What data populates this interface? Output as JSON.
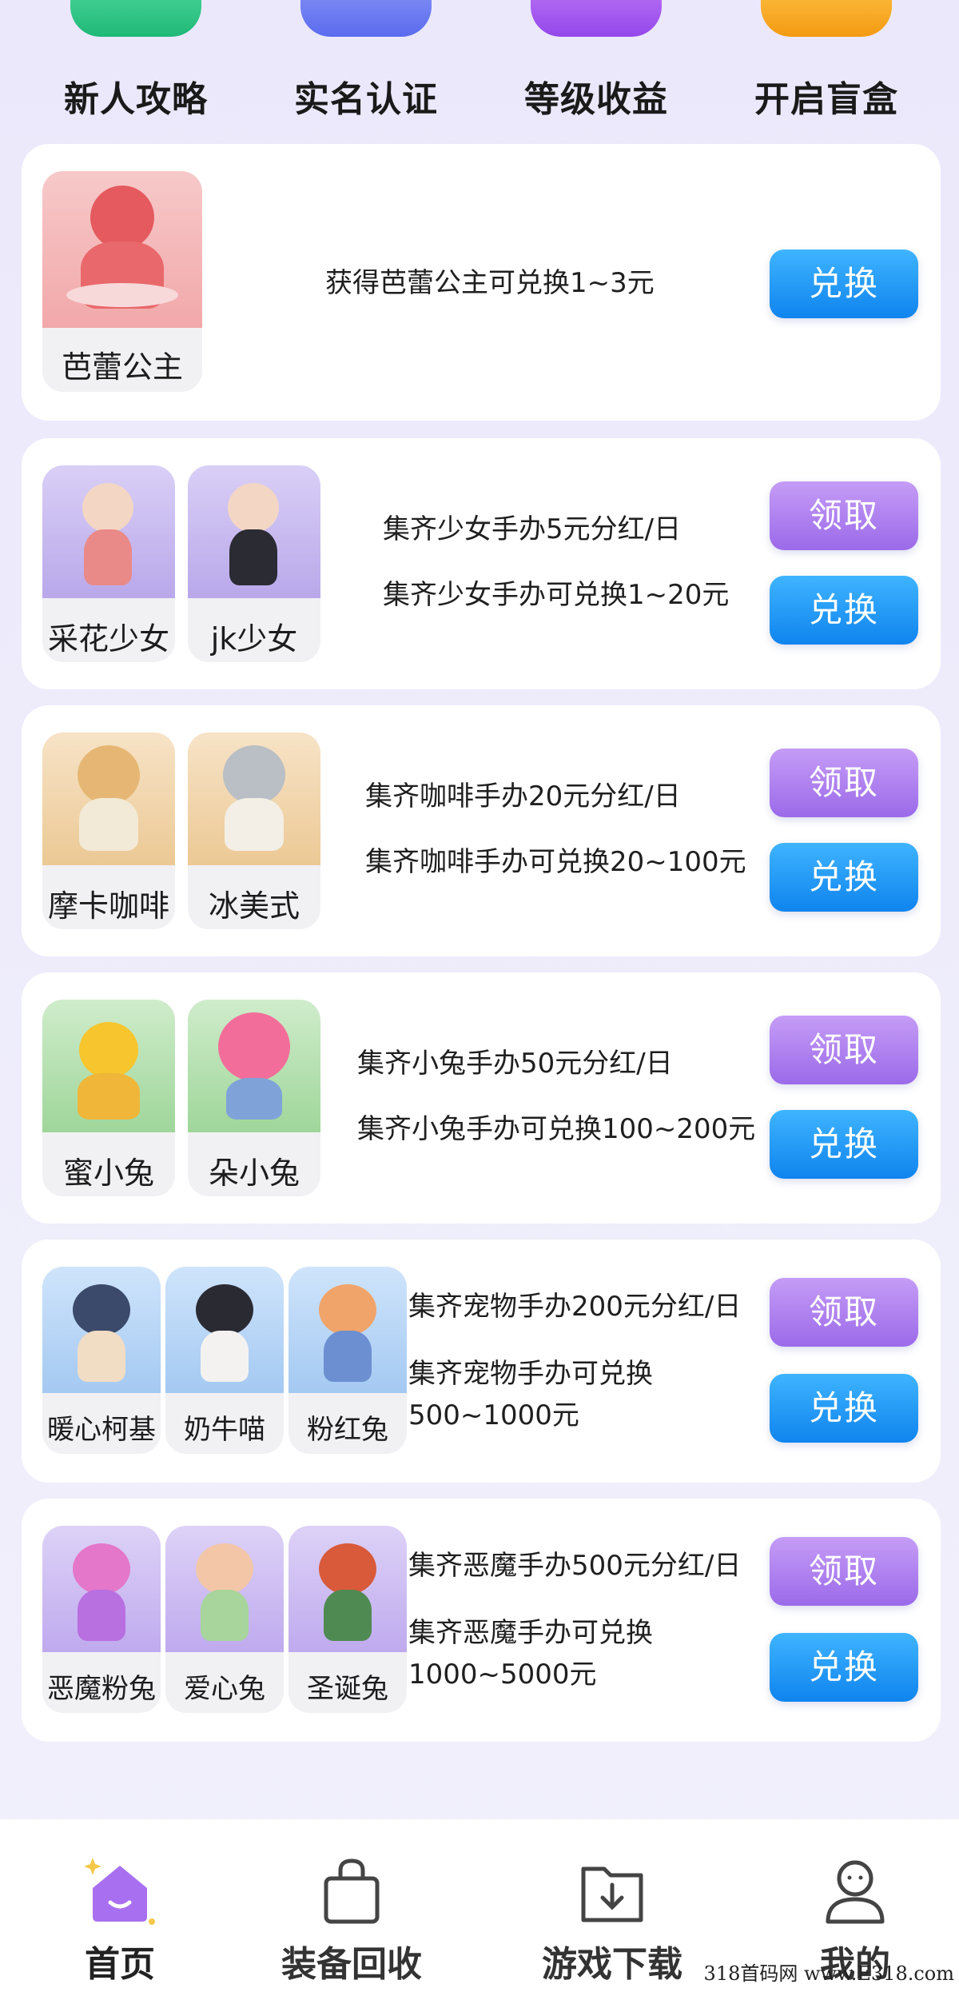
{
  "quick_nav": [
    {
      "label": "新人攻略",
      "color": "#2ecc8a",
      "icon": "guide-icon"
    },
    {
      "label": "实名认证",
      "color": "#6f7ff2",
      "icon": "id-verify-icon"
    },
    {
      "label": "等级收益",
      "color": "#a35ef0",
      "icon": "level-earnings-icon"
    },
    {
      "label": "开启盲盒",
      "color": "#f5a623",
      "icon": "blind-box-icon"
    }
  ],
  "cards": [
    {
      "figures": [
        {
          "name": "芭蕾公主"
        }
      ],
      "lines": [
        "获得芭蕾公主可兑换1~3元"
      ],
      "claim_label": null,
      "exchange_label": "兑换"
    },
    {
      "figures": [
        {
          "name": "采花少女"
        },
        {
          "name": "jk少女"
        }
      ],
      "lines": [
        "集齐少女手办5元分红/日",
        "集齐少女手办可兑换1~20元"
      ],
      "claim_label": "领取",
      "exchange_label": "兑换"
    },
    {
      "figures": [
        {
          "name": "摩卡咖啡"
        },
        {
          "name": "冰美式"
        }
      ],
      "lines": [
        "集齐咖啡手办20元分红/日",
        "集齐咖啡手办可兑换20~100元"
      ],
      "claim_label": "领取",
      "exchange_label": "兑换"
    },
    {
      "figures": [
        {
          "name": "蜜小兔"
        },
        {
          "name": "朵小兔"
        }
      ],
      "lines": [
        "集齐小兔手办50元分红/日",
        "集齐小兔手办可兑换100~200元"
      ],
      "claim_label": "领取",
      "exchange_label": "兑换"
    },
    {
      "figures": [
        {
          "name": "暖心柯基"
        },
        {
          "name": "奶牛喵"
        },
        {
          "name": "粉红兔"
        }
      ],
      "lines": [
        "集齐宠物手办200元分红/日",
        "集齐宠物手办可兑换",
        "500~1000元"
      ],
      "claim_label": "领取",
      "exchange_label": "兑换"
    },
    {
      "figures": [
        {
          "name": "恶魔粉兔"
        },
        {
          "name": "爱心兔"
        },
        {
          "name": "圣诞兔"
        }
      ],
      "lines": [
        "集齐恶魔手办500元分红/日",
        "集齐恶魔手办可兑换",
        "1000~5000元"
      ],
      "claim_label": "领取",
      "exchange_label": "兑换"
    }
  ],
  "bottom_nav": [
    {
      "label": "首页",
      "icon": "home-icon",
      "active": true
    },
    {
      "label": "装备回收",
      "icon": "shopping-bag-icon",
      "active": false
    },
    {
      "label": "游戏下载",
      "icon": "download-folder-icon",
      "active": false
    },
    {
      "label": "我的",
      "icon": "user-profile-icon",
      "active": false
    }
  ],
  "watermark": "318首码网 www.E318.com"
}
